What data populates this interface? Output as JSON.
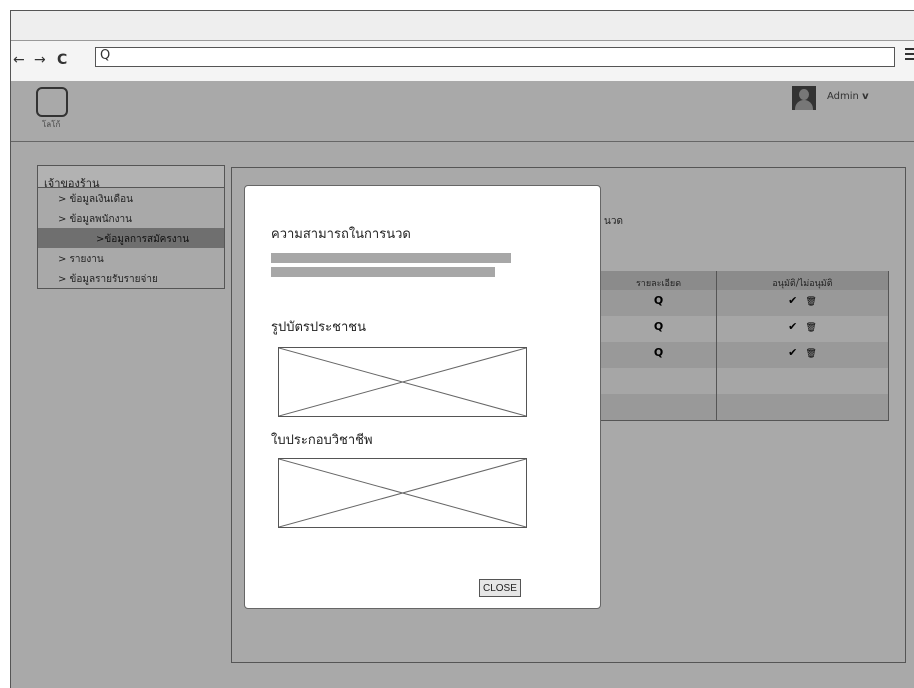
{
  "browser": {
    "nav_back": "←",
    "nav_forward": "→",
    "nav_reload": "C",
    "search_glyph": "Q"
  },
  "header": {
    "logo_text": "โลโก้",
    "user_label": "Admin",
    "user_caret": "v"
  },
  "sidebar": {
    "owner_label": "เจ้าของร้าน",
    "items": [
      {
        "label": "> ข้อมูลเงินเดือน"
      },
      {
        "label": "> ข้อมูลพนักงาน"
      },
      {
        "label": ">ข้อมูลการสมัครงาน",
        "active": true
      },
      {
        "label": "> รายงาน"
      },
      {
        "label": "> ข้อมูลรายรับรายจ่าย"
      }
    ]
  },
  "content": {
    "background_heading_fragment": "นวด",
    "table": {
      "headers": [
        "รายละเอียด",
        "อนุมัติ/ไม่อนุมัติ"
      ],
      "rows": [
        {
          "detail_icon": "search-icon",
          "actions": [
            "check-icon",
            "trash-icon"
          ]
        },
        {
          "detail_icon": "search-icon",
          "actions": [
            "check-icon",
            "trash-icon"
          ]
        },
        {
          "detail_icon": "search-icon",
          "actions": [
            "check-icon",
            "trash-icon"
          ]
        },
        {
          "detail_icon": "",
          "actions": []
        },
        {
          "detail_icon": "",
          "actions": []
        }
      ]
    }
  },
  "modal": {
    "title": "ความสามารถในการนวด",
    "section_id_card": "รูปบัตรประชาชน",
    "section_license": "ใบประกอบวิชาชีพ",
    "close_label": "CLOSE"
  },
  "colors": {
    "page_background": "#a9a9a9",
    "modal_background": "#ffffff",
    "active_nav": "#6f6f6f"
  }
}
